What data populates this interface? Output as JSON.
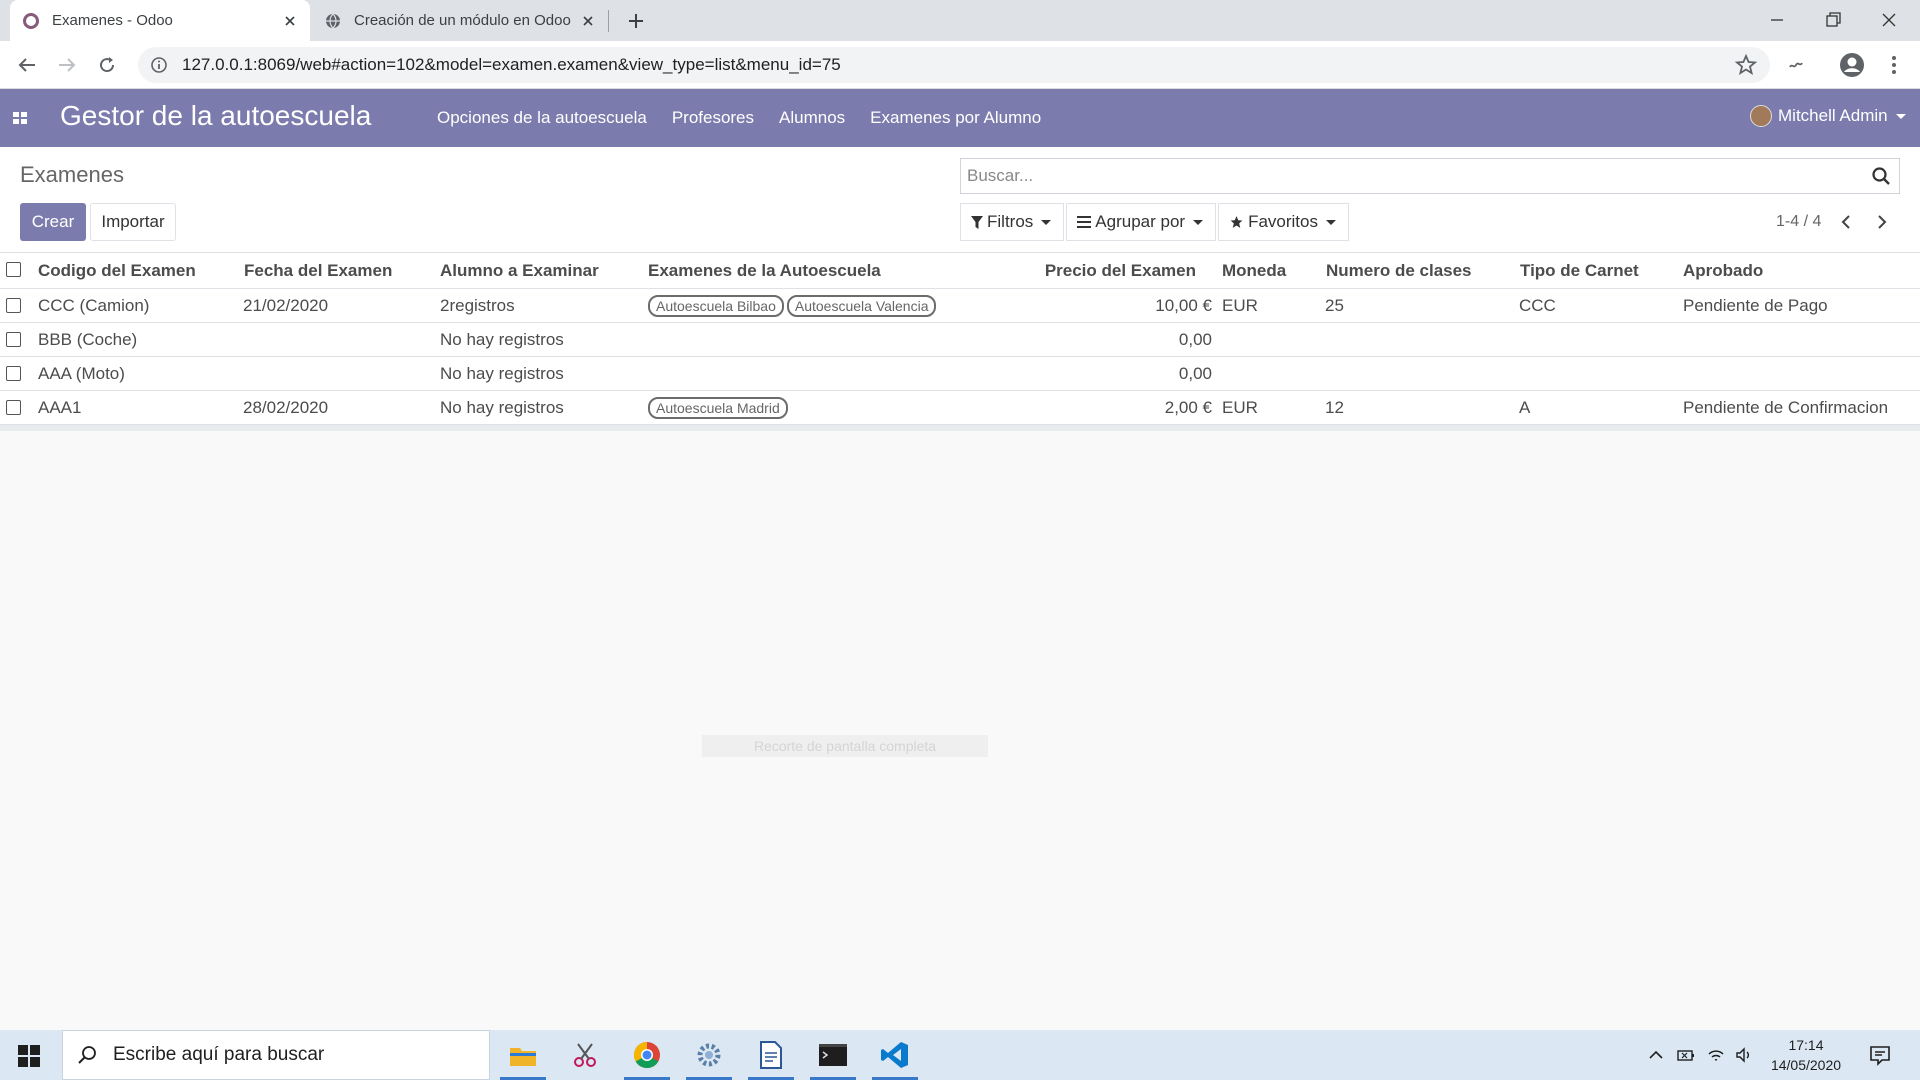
{
  "browser": {
    "tabs": [
      {
        "title": "Examenes - Odoo"
      },
      {
        "title": "Creación de un módulo en Odoo"
      }
    ],
    "url": "127.0.0.1:8069/web#action=102&model=examen.examen&view_type=list&menu_id=75"
  },
  "app": {
    "brand": "Gestor de la autoescuela",
    "menu": [
      "Opciones de la autoescuela",
      "Profesores",
      "Alumnos",
      "Examenes por Alumno"
    ],
    "user": "Mitchell Admin",
    "accent_color": "#7c7bad"
  },
  "control": {
    "title": "Examenes",
    "create_label": "Crear",
    "import_label": "Importar",
    "search_placeholder": "Buscar...",
    "filters_label": "Filtros",
    "groupby_label": "Agrupar por",
    "favorites_label": "Favoritos",
    "pager": "1-4 / 4"
  },
  "table": {
    "headers": [
      "Codigo del Examen",
      "Fecha del Examen",
      "Alumno a Examinar",
      "Examenes de la Autoescuela",
      "Precio del Examen",
      "Moneda",
      "Numero de clases",
      "Tipo de Carnet",
      "Aprobado"
    ],
    "rows": [
      {
        "code": "CCC (Camion)",
        "date": "21/02/2020",
        "student": "2registros",
        "tags": [
          "Autoescuela Bilbao",
          "Autoescuela Valencia"
        ],
        "price": "10,00 €",
        "currency": "EUR",
        "classes": "25",
        "license": "CCC",
        "approved": "Pendiente de Pago"
      },
      {
        "code": "BBB (Coche)",
        "date": "",
        "student": "No hay registros",
        "tags": [],
        "price": "0,00",
        "currency": "",
        "classes": "",
        "license": "",
        "approved": ""
      },
      {
        "code": "AAA (Moto)",
        "date": "",
        "student": "No hay registros",
        "tags": [],
        "price": "0,00",
        "currency": "",
        "classes": "",
        "license": "",
        "approved": ""
      },
      {
        "code": "AAA1",
        "date": "28/02/2020",
        "student": "No hay registros",
        "tags": [
          "Autoescuela Madrid"
        ],
        "price": "2,00 €",
        "currency": "EUR",
        "classes": "12",
        "license": "A",
        "approved": "Pendiente de Confirmacion"
      }
    ]
  },
  "overlay": {
    "ghost_text": "Recorte de pantalla completa"
  },
  "taskbar": {
    "search_placeholder": "Escribe aquí para buscar",
    "time": "17:14",
    "date": "14/05/2020",
    "apps": [
      "file-explorer-icon",
      "snipping-tool-icon",
      "chrome-icon",
      "settings-gear-icon",
      "document-icon",
      "terminal-icon",
      "vscode-icon"
    ]
  }
}
